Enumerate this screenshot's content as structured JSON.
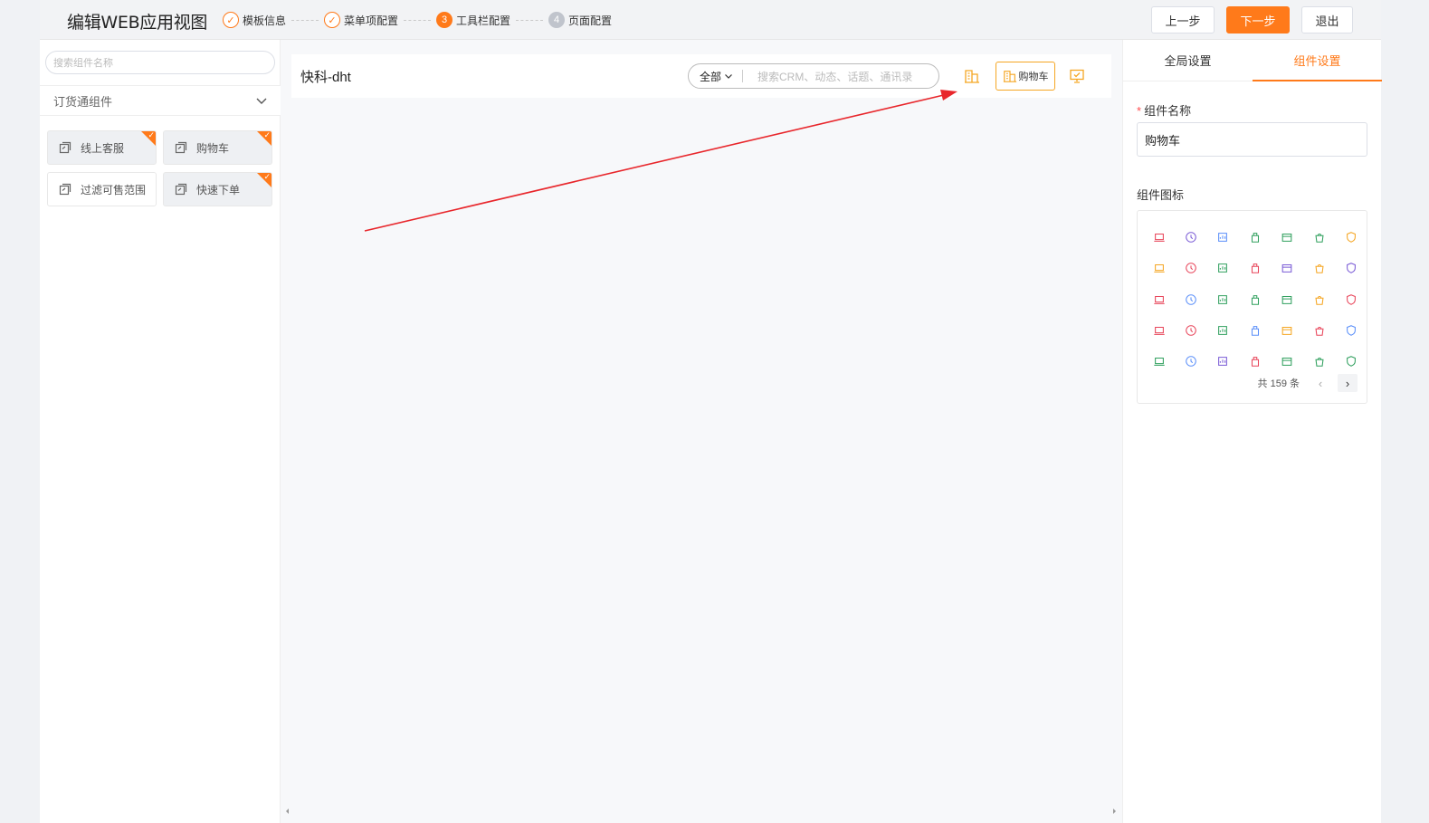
{
  "header": {
    "title": "编辑WEB应用视图",
    "steps": [
      {
        "label": "模板信息",
        "state": "done"
      },
      {
        "label": "菜单项配置",
        "state": "done"
      },
      {
        "label": "工具栏配置",
        "state": "active",
        "num": "3"
      },
      {
        "label": "页面配置",
        "state": "todo",
        "num": "4"
      }
    ],
    "buttons": {
      "prev": "上一步",
      "next": "下一步",
      "exit": "退出"
    }
  },
  "left": {
    "search_placeholder": "搜索组件名称",
    "group": "订货通组件",
    "components": [
      {
        "label": "线上客服",
        "selected": true
      },
      {
        "label": "购物车",
        "selected": true
      },
      {
        "label": "过滤可售范围",
        "selected": false
      },
      {
        "label": "快速下单",
        "selected": true
      }
    ]
  },
  "center": {
    "company": "快科-dht",
    "search_scope": "全部",
    "search_placeholder": "搜索CRM、动态、话题、通讯录",
    "cart_label": "购物车"
  },
  "right": {
    "tabs": [
      "全局设置",
      "组件设置"
    ],
    "name_label": "组件名称",
    "name_value": "购物车",
    "icon_label": "组件图标",
    "total": "共 159 条"
  },
  "colors": {
    "accent": "#ff7a1a",
    "annotation": "#e8262b"
  },
  "icon_grid": [
    {
      "n": "laptop-icon",
      "c": "#e8455a"
    },
    {
      "n": "compass-icon",
      "c": "#7b5cd6"
    },
    {
      "n": "chart-board-icon",
      "c": "#5b8ff9"
    },
    {
      "n": "bag-lock-icon",
      "c": "#31a05f"
    },
    {
      "n": "calendar-icon",
      "c": "#31a05f"
    },
    {
      "n": "shopping-bag-icon",
      "c": "#31a05f"
    },
    {
      "n": "shield-icon",
      "c": "#f5a623"
    },
    {
      "n": "presentation-icon",
      "c": "#f5a623"
    },
    {
      "n": "bookmark-icon",
      "c": "#e8455a"
    },
    {
      "n": "check-circle-icon",
      "c": "#31a05f"
    },
    {
      "n": "card-icon",
      "c": "#e8455a"
    },
    {
      "n": "globe-icon",
      "c": "#7b5cd6"
    },
    {
      "n": "target-icon",
      "c": "#f5a623"
    },
    {
      "n": "calendar-grid-icon",
      "c": "#7b5cd6"
    },
    {
      "n": "inbox-icon",
      "c": "#e8455a"
    },
    {
      "n": "archive-icon",
      "c": "#5b8ff9"
    },
    {
      "n": "pencil-icon",
      "c": "#31a05f"
    },
    {
      "n": "checkbox-icon",
      "c": "#31a05f"
    },
    {
      "n": "line-chart-icon",
      "c": "#31a05f"
    },
    {
      "n": "sign-icon",
      "c": "#f5a623"
    },
    {
      "n": "clipboard-icon",
      "c": "#e8455a"
    },
    {
      "n": "bar-chart-icon",
      "c": "#e8455a"
    },
    {
      "n": "radar-icon",
      "c": "#e8455a"
    },
    {
      "n": "cross-icon",
      "c": "#31a05f"
    },
    {
      "n": "window-icon",
      "c": "#5b8ff9"
    },
    {
      "n": "building-icon",
      "c": "#f5a623"
    },
    {
      "n": "pie-clock-icon",
      "c": "#e8455a"
    },
    {
      "n": "home-icon",
      "c": "#5b8ff9"
    },
    {
      "n": "monitor-icon",
      "c": "#31a05f"
    },
    {
      "n": "drive-icon",
      "c": "#5b8ff9"
    },
    {
      "n": "apps-icon",
      "c": "#7b5cd6"
    },
    {
      "n": "gift-icon",
      "c": "#e8455a"
    },
    {
      "n": "doc-chart-icon",
      "c": "#31a05f"
    },
    {
      "n": "save-icon",
      "c": "#31a05f"
    },
    {
      "n": "security-icon",
      "c": "#31a05f"
    }
  ]
}
